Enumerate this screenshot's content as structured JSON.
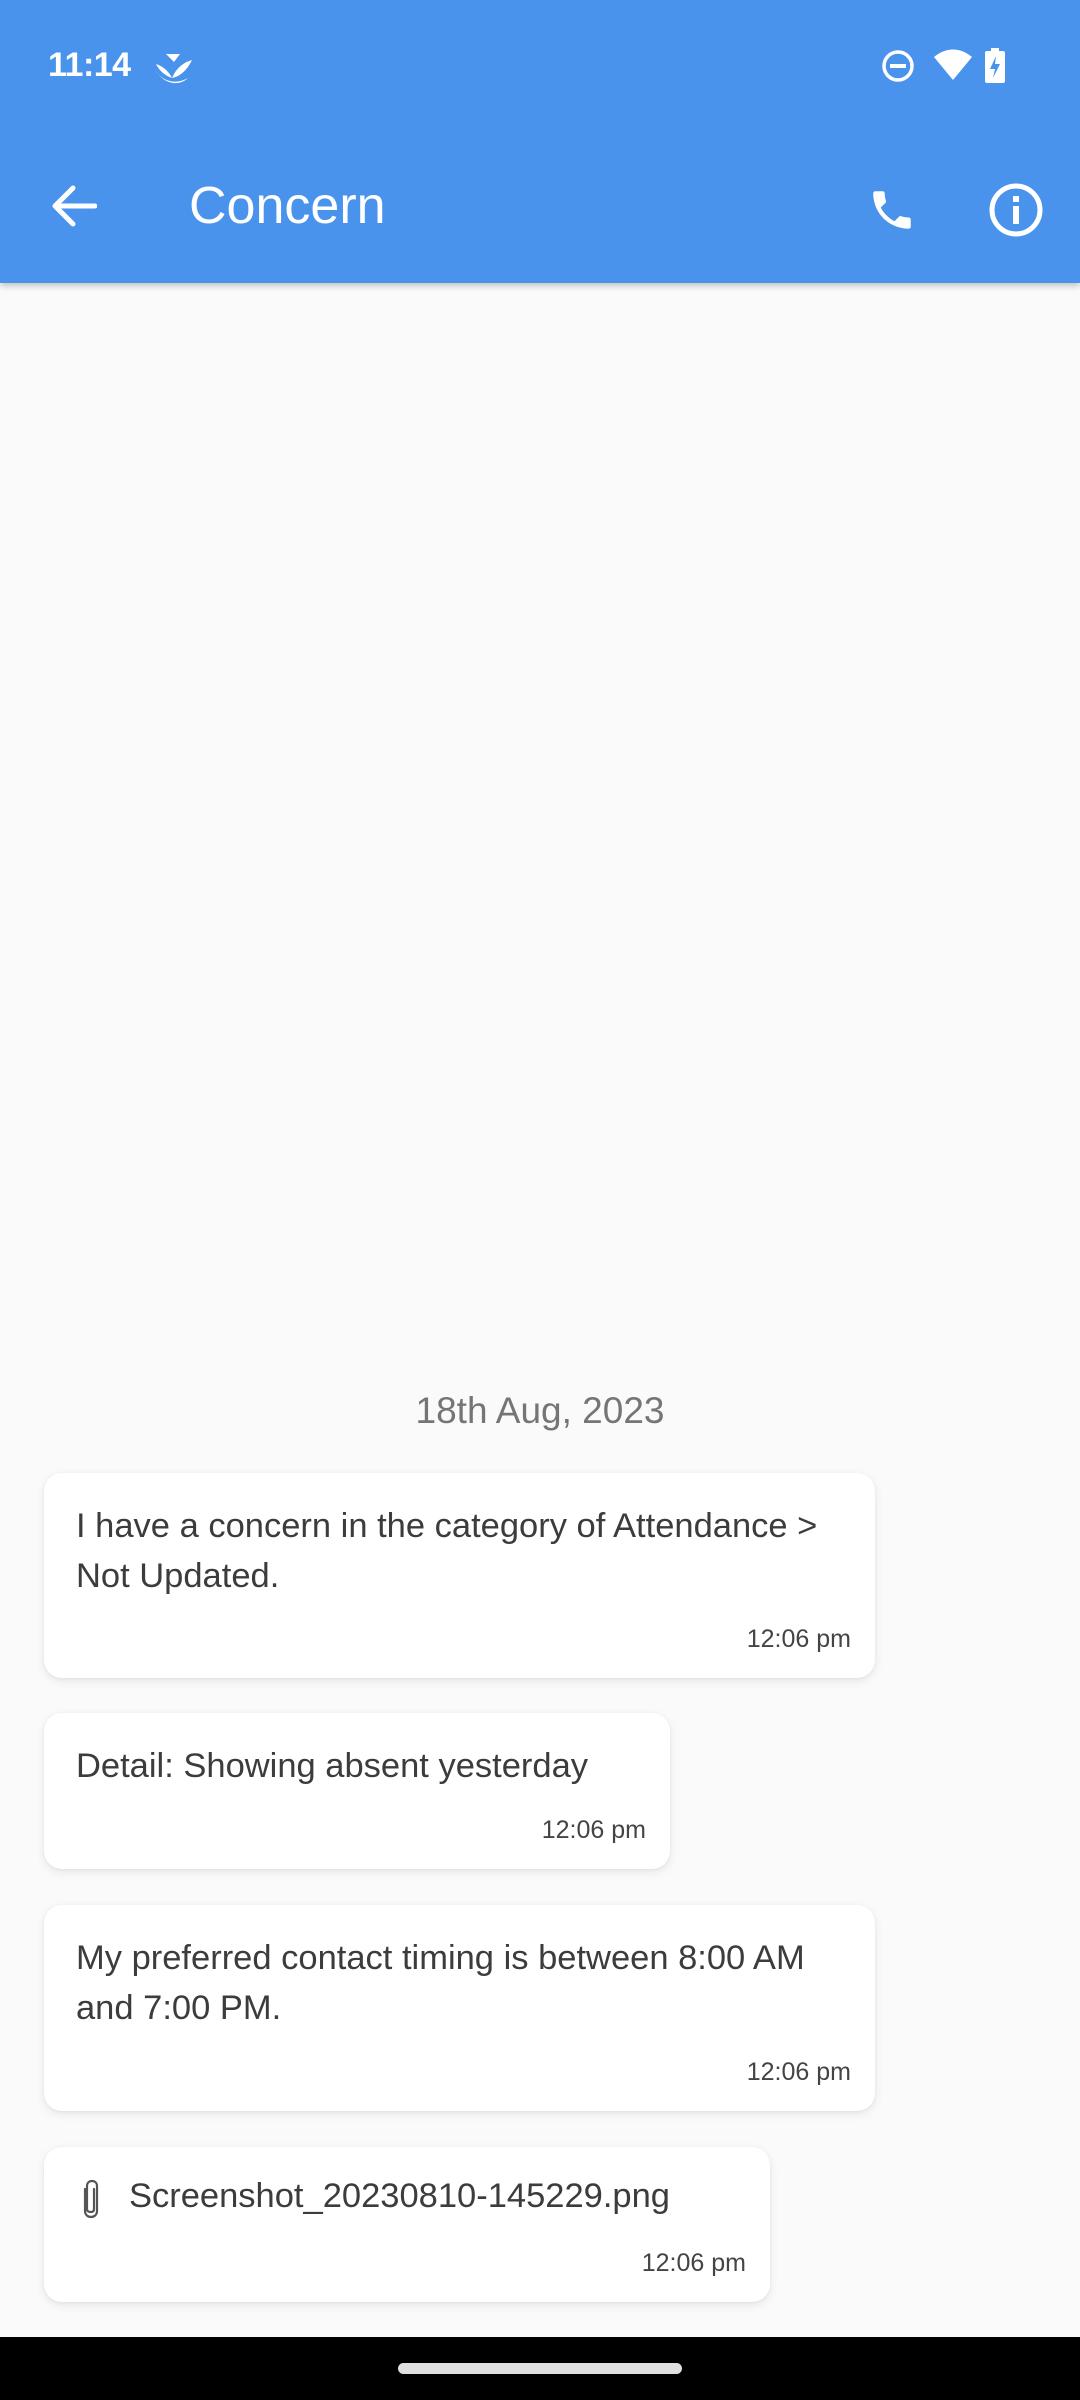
{
  "status_bar": {
    "time": "11:14",
    "icons": [
      "app-notification-icon",
      "do-not-disturb-icon",
      "wifi-icon",
      "battery-charging-icon"
    ]
  },
  "app_bar": {
    "title": "Concern",
    "back_icon": "arrow-back-icon",
    "actions": [
      "phone-icon",
      "info-icon"
    ],
    "color": "#4a93ec"
  },
  "conversation": {
    "date": "18th Aug, 2023",
    "messages": [
      {
        "text": "I have a concern in the category of Attendance > Not Updated.",
        "time": "12:06 pm"
      },
      {
        "text": "Detail: Showing absent yesterday",
        "time": "12:06 pm"
      },
      {
        "text": "My preferred contact timing is between 8:00 AM and 7:00 PM.",
        "time": "12:06 pm"
      },
      {
        "text": "Screenshot_20230810-145229.png",
        "time": "12:06 pm",
        "attachment": true,
        "icon": "paperclip-icon"
      }
    ]
  }
}
